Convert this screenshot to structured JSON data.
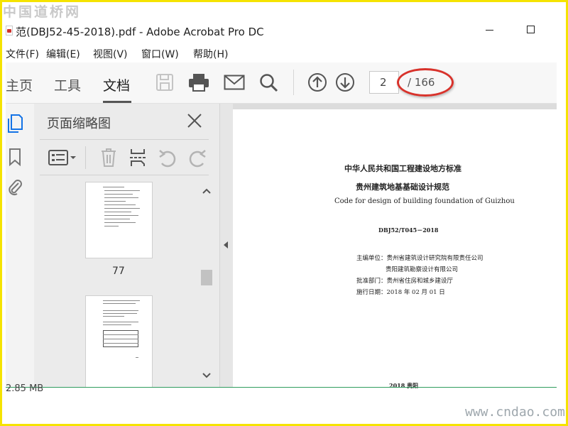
{
  "watermarks": {
    "top": "中国道桥网",
    "bottom": "www.cndao.com"
  },
  "window": {
    "title": "范(DBJ52-45-2018).pdf - Adobe Acrobat Pro DC"
  },
  "menu": [
    "文件(F)",
    "编辑(E)",
    "视图(V)",
    "窗口(W)",
    "帮助(H)"
  ],
  "toolbar": {
    "tabs": [
      "主页",
      "工具",
      "文档"
    ],
    "active_tab": "文档",
    "icons": [
      "save-icon",
      "print-icon",
      "email-icon",
      "search-icon",
      "page-up-icon",
      "page-down-icon"
    ],
    "page_current": "2",
    "page_total": "/ 166",
    "highlight_color": "#d8322b"
  },
  "sidebar_rail": {
    "icons": [
      "page-thumbnails-icon",
      "bookmarks-icon",
      "attachments-icon"
    ]
  },
  "thumbnail_panel": {
    "title": "页面缩略图",
    "tools": [
      "options-icon",
      "delete-icon",
      "insert-pages-icon",
      "rotate-ccw-icon",
      "rotate-cw-icon"
    ],
    "thumbnails": [
      {
        "label": "77"
      },
      {
        "label": ""
      }
    ]
  },
  "document": {
    "lines": [
      "中华人民共和国工程建设地方标准",
      "贵州建筑地基基础设计规范",
      "Code for design of building foundation of Guizhou",
      "DBJ52/T045－2018",
      "主编单位：贵州省建筑设计研究院有限责任公司",
      "贵阳建筑勘察设计有限公司",
      "批准部门：贵州省住房和城乡建设厅",
      "施行日期：2018 年 02 月 01 日",
      "2018    贵阳"
    ]
  },
  "status": {
    "file_size": "2.85 MB"
  },
  "colors": {
    "status_line": "#2f9c5e",
    "frame": "#f5e300"
  }
}
